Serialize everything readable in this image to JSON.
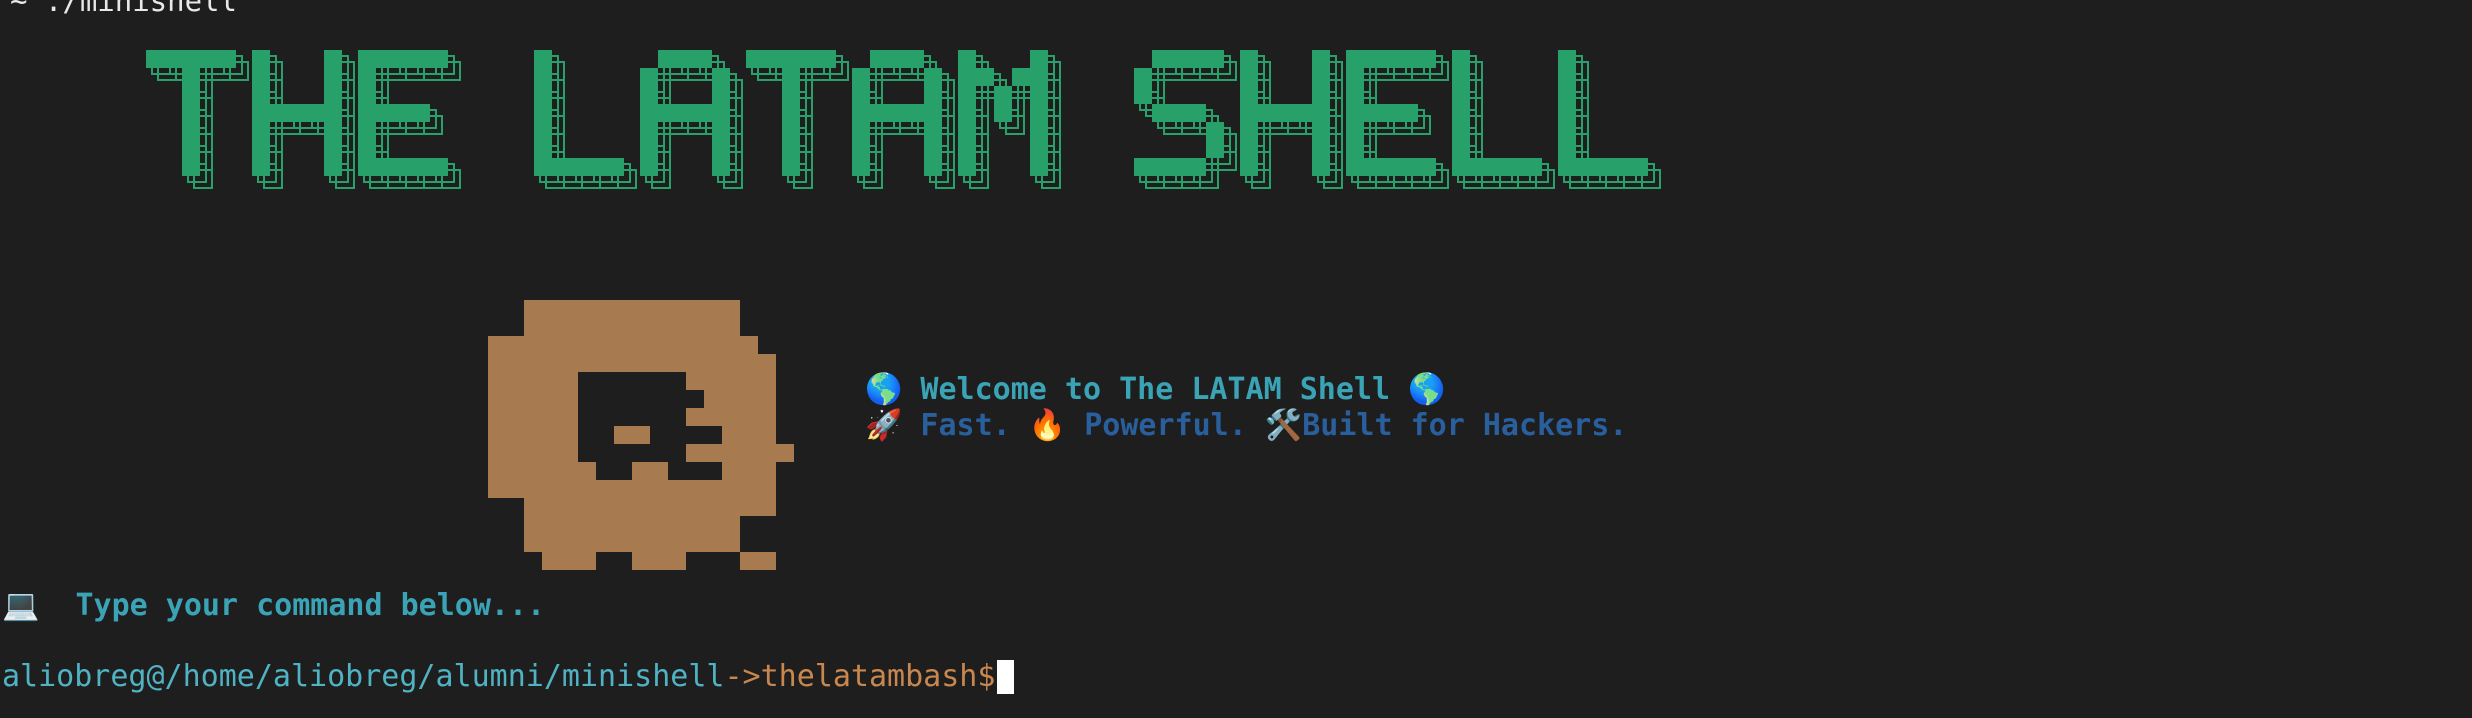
{
  "window": {
    "cwd_line": "~ ./minishell"
  },
  "banner": {
    "title": "THE LATAM SHELL",
    "title_color": "#27a06a",
    "outline_color": "#27a06a",
    "skull_color": "#a87a4f",
    "skull_icon": "pixel-skull-icon"
  },
  "welcome": {
    "line1_emoji_left": "🌎",
    "line1_text": "Welcome to The LATAM Shell",
    "line1_emoji_right": "🌎",
    "line2_emoji_1": "🚀",
    "line2_text_1": "Fast.",
    "line2_emoji_2": "🔥",
    "line2_text_2": "Powerful.",
    "line2_emoji_3": "🛠️",
    "line2_text_3": "Built for Hackers."
  },
  "hint": {
    "emoji": "💻",
    "text": "Type your command below..."
  },
  "prompt": {
    "path": "aliobreg@/home/aliobreg/alumni/minishell",
    "arrow": "->",
    "shell": "thelatambash$"
  },
  "colors": {
    "background": "#1e1e1e",
    "cyan": "#3aa4b6",
    "blue": "#2a5f9e",
    "orange": "#c8874f"
  }
}
